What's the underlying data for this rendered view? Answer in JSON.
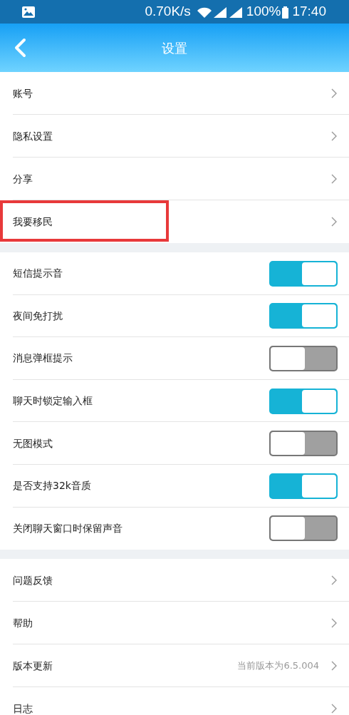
{
  "status_bar": {
    "speed": "0.70K/s",
    "battery": "100%",
    "time": "17:40"
  },
  "header": {
    "title": "设置"
  },
  "sections": [
    {
      "items": [
        {
          "kind": "link",
          "label": "账号",
          "highlighted": false
        },
        {
          "kind": "link",
          "label": "隐私设置",
          "highlighted": false
        },
        {
          "kind": "link",
          "label": "分享",
          "highlighted": false
        },
        {
          "kind": "link",
          "label": "我要移民",
          "highlighted": true
        }
      ]
    },
    {
      "items": [
        {
          "kind": "toggle",
          "label": "短信提示音",
          "on": true
        },
        {
          "kind": "toggle",
          "label": "夜间免打扰",
          "on": true
        },
        {
          "kind": "toggle",
          "label": "消息弹框提示",
          "on": false
        },
        {
          "kind": "toggle",
          "label": "聊天时锁定输入框",
          "on": true
        },
        {
          "kind": "toggle",
          "label": "无图模式",
          "on": false
        },
        {
          "kind": "toggle",
          "label": "是否支持32k音质",
          "on": true
        },
        {
          "kind": "toggle",
          "label": "关闭聊天窗口时保留声音",
          "on": false
        }
      ]
    },
    {
      "items": [
        {
          "kind": "link",
          "label": "问题反馈",
          "highlighted": false
        },
        {
          "kind": "link",
          "label": "帮助",
          "highlighted": false
        },
        {
          "kind": "link",
          "label": "版本更新",
          "value": "当前版本为6.5.004",
          "highlighted": false
        },
        {
          "kind": "link",
          "label": "日志",
          "highlighted": false
        }
      ]
    }
  ]
}
